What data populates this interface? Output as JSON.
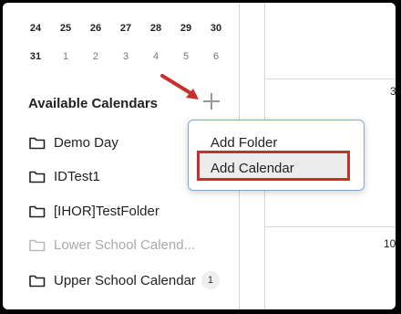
{
  "calendar": {
    "row1": [
      "24",
      "25",
      "26",
      "27",
      "28",
      "29",
      "30"
    ],
    "row2": [
      "31",
      "1",
      "2",
      "3",
      "4",
      "5",
      "6"
    ]
  },
  "available": {
    "title": "Available Calendars",
    "add_icon": "plus-icon",
    "items": [
      {
        "label": "Demo Day"
      },
      {
        "label": "IDTest1"
      },
      {
        "label": "[IHOR]TestFolder"
      },
      {
        "label": "Lower School Calend..."
      },
      {
        "label": "Upper School Calendar",
        "badge": "1"
      }
    ]
  },
  "main": {
    "day_top": "3",
    "day_bottom": "10"
  },
  "dropdown": {
    "add_folder": "Add Folder",
    "add_calendar": "Add Calendar"
  },
  "colors": {
    "highlight": "#c8312b",
    "dropdown_border": "#7fa8d8"
  }
}
